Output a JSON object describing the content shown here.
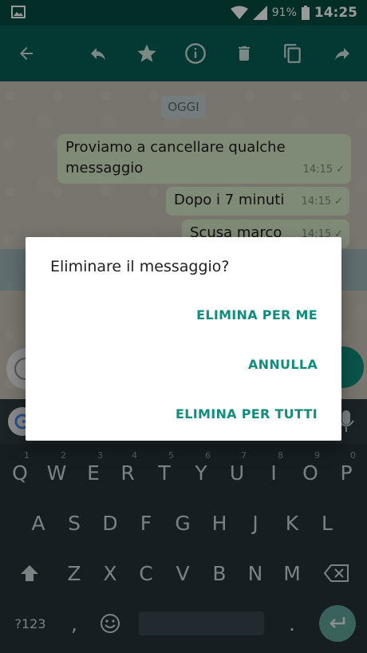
{
  "status_bar": {
    "battery": "91%",
    "time": "14:25",
    "icons": [
      "image-icon",
      "wifi-icon",
      "signal-icon",
      "battery-icon"
    ]
  },
  "toolbar": {
    "icons": [
      "back-arrow-icon",
      "reply-icon",
      "star-icon",
      "info-icon",
      "delete-icon",
      "copy-icon",
      "forward-icon"
    ]
  },
  "chat": {
    "date_chip": "OGGI",
    "messages": [
      {
        "text": "Proviamo a cancellare qualche messaggio",
        "time": "14:15"
      },
      {
        "text": "Dopo i 7 minuti",
        "time": "14:15"
      },
      {
        "text": "Scusa marco",
        "time": "14:15"
      }
    ]
  },
  "dialog": {
    "title": "Eliminare il messaggio?",
    "buttons": {
      "delete_for_me": "ELIMINA PER ME",
      "cancel": "ANNULLA",
      "delete_for_all": "ELIMINA PER TUTTI"
    }
  },
  "keyboard": {
    "row1": [
      {
        "key": "Q",
        "num": "1"
      },
      {
        "key": "W",
        "num": "2"
      },
      {
        "key": "E",
        "num": "3"
      },
      {
        "key": "R",
        "num": "4"
      },
      {
        "key": "T",
        "num": "5"
      },
      {
        "key": "Y",
        "num": "6"
      },
      {
        "key": "U",
        "num": "7"
      },
      {
        "key": "I",
        "num": "8"
      },
      {
        "key": "O",
        "num": "9"
      },
      {
        "key": "P",
        "num": "0"
      }
    ],
    "row2": [
      "A",
      "S",
      "D",
      "F",
      "G",
      "H",
      "J",
      "K",
      "L"
    ],
    "row3": [
      "Z",
      "X",
      "C",
      "V",
      "B",
      "N",
      "M"
    ],
    "symbols_key": "?123",
    "comma_key": ","
  },
  "colors": {
    "status_bar": "#054c41",
    "toolbar": "#075e54",
    "accent": "#128c7e",
    "bubble": "#d6e8c6",
    "keyboard_bg": "#263238"
  }
}
